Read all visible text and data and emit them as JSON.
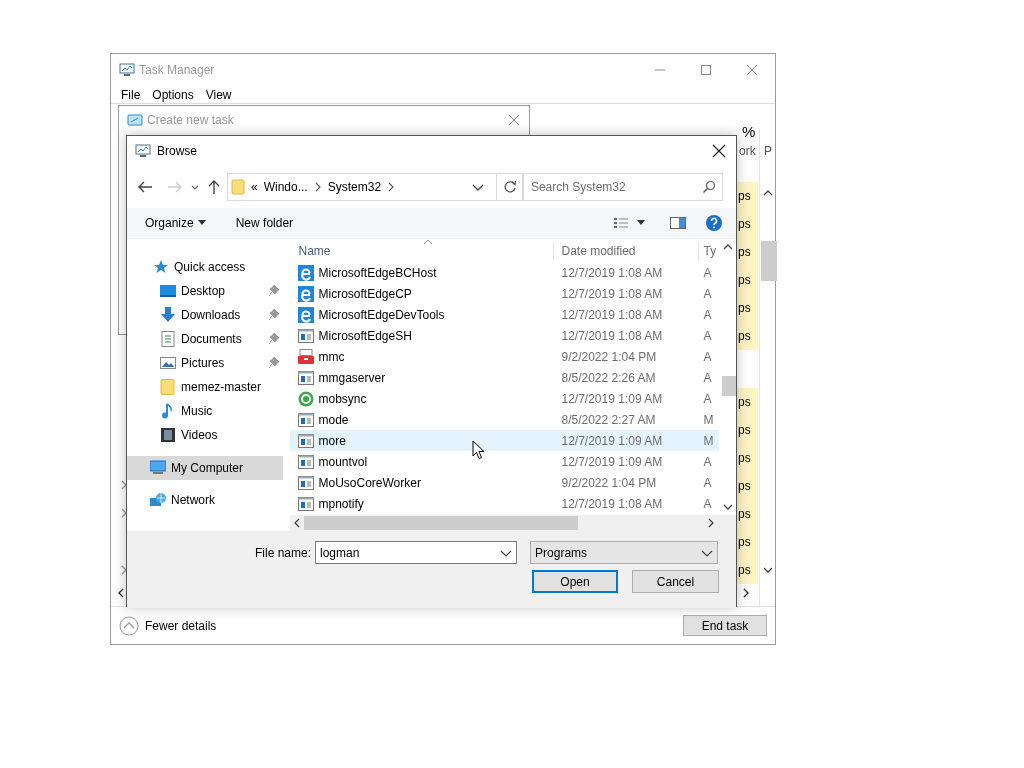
{
  "task_manager": {
    "title": "Task Manager",
    "menu": [
      {
        "label": "File"
      },
      {
        "label": "Options"
      },
      {
        "label": "View"
      }
    ],
    "column_headers": {
      "column_4_top": "%",
      "column_4": "ork",
      "column_5": "P"
    },
    "column_4_groups": [
      {
        "cells": [
          "ps",
          "ps",
          "ps",
          "ps",
          "ps",
          "ps"
        ]
      },
      {
        "cells": [
          "ps",
          "ps",
          "ps",
          "ps",
          "ps",
          "ps",
          "ps"
        ]
      }
    ],
    "details_toggle": "Fewer details",
    "end_task_button": "End task"
  },
  "create_task": {
    "title": "Create new task"
  },
  "browse": {
    "title": "Browse",
    "address": {
      "overflow": "«",
      "segments": [
        "Windo...",
        "System32"
      ]
    },
    "search": {
      "placeholder": "Search System32"
    },
    "toolbar": {
      "organize": "Organize",
      "new_folder": "New folder"
    },
    "nav": [
      {
        "label": "Quick access",
        "kind": "star",
        "selected": false,
        "children": [
          {
            "label": "Desktop",
            "kind": "desktop",
            "pinned": true,
            "selected": false
          },
          {
            "label": "Downloads",
            "kind": "downloads",
            "pinned": true,
            "selected": false
          },
          {
            "label": "Documents",
            "kind": "documents",
            "pinned": true,
            "selected": false
          },
          {
            "label": "Pictures",
            "kind": "pictures",
            "pinned": true,
            "selected": false
          },
          {
            "label": "memez-master",
            "kind": "folder",
            "pinned": false,
            "selected": false
          },
          {
            "label": "Music",
            "kind": "music",
            "pinned": false,
            "selected": false
          },
          {
            "label": "Videos",
            "kind": "videos",
            "pinned": false,
            "selected": false
          }
        ]
      },
      {
        "label": "My Computer",
        "kind": "computer",
        "selected": true
      },
      {
        "label": "Network",
        "kind": "network",
        "selected": false
      }
    ],
    "columns": [
      "Name",
      "Date modified",
      "Ty"
    ],
    "files": [
      {
        "name": "MicrosoftEdgeBCHost",
        "date": "12/7/2019 1:08 AM",
        "type": "A",
        "kind": "edge",
        "hovered": false
      },
      {
        "name": "MicrosoftEdgeCP",
        "date": "12/7/2019 1:08 AM",
        "type": "A",
        "kind": "edge",
        "hovered": false
      },
      {
        "name": "MicrosoftEdgeDevTools",
        "date": "12/7/2019 1:08 AM",
        "type": "A",
        "kind": "edge",
        "hovered": false
      },
      {
        "name": "MicrosoftEdgeSH",
        "date": "12/7/2019 1:08 AM",
        "type": "A",
        "kind": "app",
        "hovered": false
      },
      {
        "name": "mmc",
        "date": "9/2/2022 1:04 PM",
        "type": "A",
        "kind": "toolbox",
        "hovered": false
      },
      {
        "name": "mmgaserver",
        "date": "8/5/2022 2:26 AM",
        "type": "A",
        "kind": "app",
        "hovered": false
      },
      {
        "name": "mobsync",
        "date": "12/7/2019 1:09 AM",
        "type": "A",
        "kind": "sync",
        "hovered": false
      },
      {
        "name": "mode",
        "date": "8/5/2022 2:27 AM",
        "type": "M",
        "kind": "app",
        "hovered": false
      },
      {
        "name": "more",
        "date": "12/7/2019 1:09 AM",
        "type": "M",
        "kind": "app",
        "hovered": true
      },
      {
        "name": "mountvol",
        "date": "12/7/2019 1:09 AM",
        "type": "A",
        "kind": "app",
        "hovered": false
      },
      {
        "name": "MoUsoCoreWorker",
        "date": "9/2/2022 1:04 PM",
        "type": "A",
        "kind": "app",
        "hovered": false
      },
      {
        "name": "mpnotify",
        "date": "12/7/2019 1:08 AM",
        "type": "A",
        "kind": "app",
        "hovered": false
      }
    ],
    "file_name_label": "File name:",
    "file_name": "logman",
    "filter": "Programs",
    "open_button": "Open",
    "cancel_button": "Cancel"
  }
}
